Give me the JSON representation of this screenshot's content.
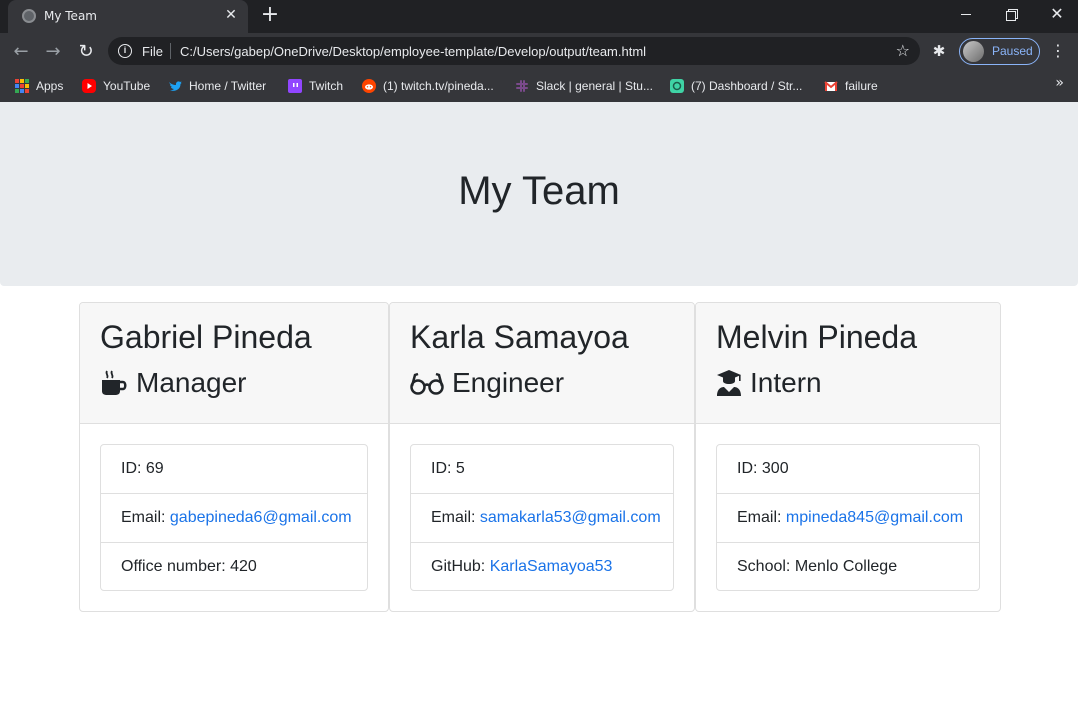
{
  "browser": {
    "tab_title": "My Team",
    "file_label": "File",
    "url": "C:/Users/gabep/OneDrive/Desktop/employee-template/Develop/output/team.html",
    "profile_label": "Paused",
    "bookmarks": [
      {
        "label": "Apps",
        "icon": "apps-grid-icon"
      },
      {
        "label": "YouTube",
        "icon": "youtube-icon"
      },
      {
        "label": "Home / Twitter",
        "icon": "twitter-icon"
      },
      {
        "label": "Twitch",
        "icon": "twitch-icon"
      },
      {
        "label": "(1) twitch.tv/pineda...",
        "icon": "reddit-icon"
      },
      {
        "label": "Slack | general | Stu...",
        "icon": "slack-icon"
      },
      {
        "label": "(7) Dashboard / Str...",
        "icon": "dashboard-icon"
      },
      {
        "label": "failure",
        "icon": "gmail-icon"
      }
    ]
  },
  "page": {
    "title": "My Team"
  },
  "team": [
    {
      "name": "Gabriel Pineda",
      "role": "Manager",
      "role_icon": "mug-icon",
      "id_label": "ID: 69",
      "email_prefix": "Email: ",
      "email": "gabepineda6@gmail.com",
      "extra_label": "Office number: 420"
    },
    {
      "name": "Karla Samayoa",
      "role": "Engineer",
      "role_icon": "glasses-icon",
      "id_label": "ID: 5",
      "email_prefix": "Email: ",
      "email": "samakarla53@gmail.com",
      "extra_prefix": "GitHub: ",
      "extra_link": "KarlaSamayoa53"
    },
    {
      "name": "Melvin Pineda",
      "role": "Intern",
      "role_icon": "graduate-icon",
      "id_label": "ID: 300",
      "email_prefix": "Email: ",
      "email": "mpineda845@gmail.com",
      "extra_label": "School: Menlo College"
    }
  ],
  "colors": {
    "jumbotron": "#e9ecef",
    "link": "#1a73e8",
    "card_header": "#f7f7f7"
  }
}
